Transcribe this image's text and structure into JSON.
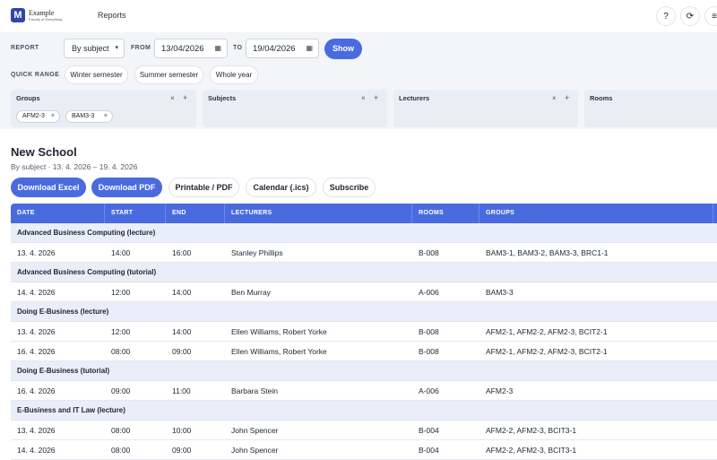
{
  "header": {
    "logo_letter": "M",
    "brand_name": "Example",
    "brand_tagline": "Faculty of Everything",
    "nav_reports": "Reports",
    "help_glyph": "?",
    "refresh_glyph": "⟳",
    "menu_glyph": "≡"
  },
  "filters": {
    "report_label": "REPORT",
    "report_value": "By subject",
    "from_label": "FROM",
    "from_value": "13/04/2026",
    "to_label": "TO",
    "to_value": "19/04/2026",
    "show_label": "Show",
    "quick_label": "QUICK RANGE",
    "quick": [
      "Winter semester",
      "Summer semester",
      "Whole year"
    ],
    "panels": {
      "groups": {
        "title": "Groups",
        "tags": [
          "AFM2-3",
          "BAM3-3"
        ]
      },
      "subjects": {
        "title": "Subjects"
      },
      "lecturers": {
        "title": "Lecturers"
      },
      "rooms": {
        "title": "Rooms"
      }
    },
    "x_glyph": "×",
    "plus_glyph": "+"
  },
  "content": {
    "title": "New School",
    "subtitle": "By subject  ·  13. 4. 2026 – 19. 4. 2026",
    "actions": [
      "Download Excel",
      "Download PDF",
      "Printable / PDF",
      "Calendar (.ics)",
      "Subscribe"
    ]
  },
  "table": {
    "headers": [
      "DATE",
      "START",
      "END",
      "LECTURERS",
      "ROOMS",
      "GROUPS"
    ],
    "groups": [
      {
        "name": "Advanced Business Computing (lecture)",
        "rows": [
          [
            "13. 4. 2026",
            "14:00",
            "16:00",
            "Stanley Phillips",
            "B-008",
            "BAM3-1, BAM3-2, BAM3-3, BRC1-1"
          ]
        ]
      },
      {
        "name": "Advanced Business Computing (tutorial)",
        "rows": [
          [
            "14. 4. 2026",
            "12:00",
            "14:00",
            "Ben Murray",
            "A-006",
            "BAM3-3"
          ]
        ]
      },
      {
        "name": "Doing E-Business (lecture)",
        "rows": [
          [
            "13. 4. 2026",
            "12:00",
            "14:00",
            "Ellen Williams, Robert Yorke",
            "B-008",
            "AFM2-1, AFM2-2, AFM2-3, BCIT2-1"
          ],
          [
            "16. 4. 2026",
            "08:00",
            "09:00",
            "Ellen Williams, Robert Yorke",
            "B-008",
            "AFM2-1, AFM2-2, AFM2-3, BCIT2-1"
          ]
        ]
      },
      {
        "name": "Doing E-Business (tutorial)",
        "rows": [
          [
            "16. 4. 2026",
            "09:00",
            "11:00",
            "Barbara Stein",
            "A-006",
            "AFM2-3"
          ]
        ]
      },
      {
        "name": "E-Business and IT Law (lecture)",
        "rows": [
          [
            "13. 4. 2026",
            "08:00",
            "10:00",
            "John Spencer",
            "B-004",
            "AFM2-2, AFM2-3, BCIT3-1"
          ],
          [
            "14. 4. 2026",
            "08:00",
            "09:00",
            "John Spencer",
            "B-004",
            "AFM2-2, AFM2-3, BCIT3-1"
          ]
        ]
      }
    ]
  }
}
